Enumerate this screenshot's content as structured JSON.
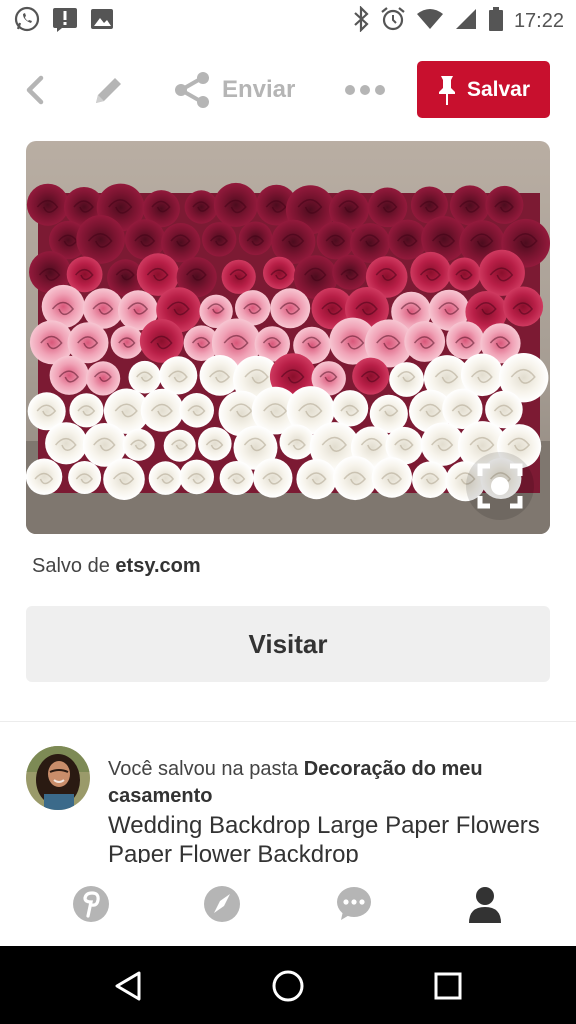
{
  "status_bar": {
    "time": "17:22",
    "left_icons": [
      "whatsapp-icon",
      "alert-icon",
      "image-icon"
    ],
    "right_icons": [
      "bluetooth-icon",
      "alarm-icon",
      "wifi-icon",
      "signal-icon",
      "battery-icon"
    ]
  },
  "action_bar": {
    "send_label": "Enviar",
    "save_label": "Salvar",
    "icons": [
      "back-icon",
      "edit-icon",
      "share-icon",
      "more-icon",
      "pin-icon"
    ]
  },
  "pin": {
    "image_subject": "paper flower wall backdrop",
    "saved_from_prefix": "Salvo de",
    "saved_from_domain": "etsy.com",
    "visit_label": "Visitar",
    "saved_prefix": "Você salvou na pasta",
    "board_name": "Decoração do meu casamento",
    "description": "Wedding Backdrop Large Paper Flowers Paper Flower Backdrop"
  },
  "colors": {
    "brand_red": "#c8102e",
    "visit_bg": "#efefef",
    "nav_icon": "#b5b5b5",
    "nav_active": "#333333"
  },
  "bottom_nav": {
    "items": [
      "home-icon",
      "explore-icon",
      "messages-icon",
      "profile-icon"
    ],
    "active": "profile-icon"
  },
  "system_nav": {
    "items": [
      "back-triangle-icon",
      "home-circle-icon",
      "recents-square-icon"
    ]
  }
}
